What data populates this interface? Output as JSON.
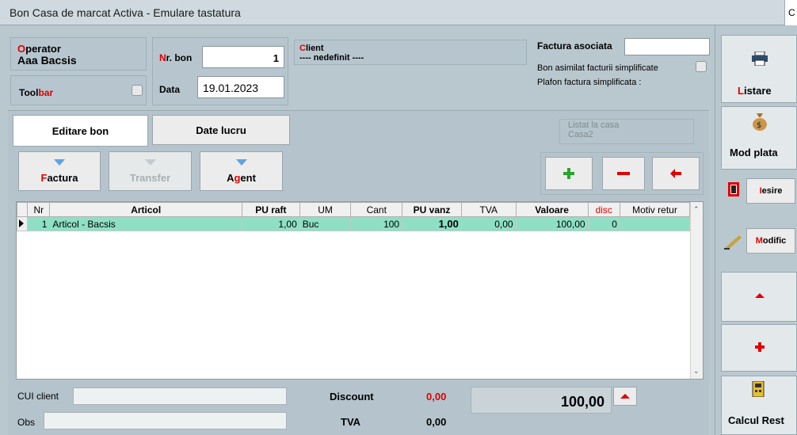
{
  "window": {
    "title": "Bon Casa de marcat Activa - Emulare tastatura",
    "corner": "C"
  },
  "operator": {
    "label_hot": "O",
    "label_rest": "perator",
    "name": "Aaa Bacsis"
  },
  "toolbar": {
    "label_hot": "Tool",
    "label_rest": "bar"
  },
  "bon": {
    "nr_label_hot": "N",
    "nr_label_rest": "r. bon",
    "nr_value": "1",
    "data_label": "Data",
    "data_value": "19.01.2023"
  },
  "client": {
    "label_hot": "C",
    "label_rest": "lient",
    "value": "---- nedefinit ----"
  },
  "factura": {
    "asociata_label": "Factura asociata",
    "asociata_value": "",
    "asimilat_label": "Bon asimilat facturii simplificate",
    "plafon_label": "Plafon factura simplificata :"
  },
  "tabs": {
    "editare": "Editare bon",
    "date": "Date lucru"
  },
  "listat": {
    "label": "Listat la casa",
    "value": "Casa2"
  },
  "actions": {
    "factura_hot": "F",
    "factura_rest": "actura",
    "transfer": "Transfer",
    "agent_a": "A",
    "agent_hot": "g",
    "agent_rest": "ent"
  },
  "grid": {
    "columns": [
      "Nr",
      "Articol",
      "PU raft",
      "UM",
      "Cant",
      "PU vanz",
      "TVA",
      "Valoare",
      "disc",
      "Motiv retur"
    ],
    "rows": [
      {
        "nr": "1",
        "articol": "Articol - Bacsis",
        "pu_raft": "1,00",
        "um": "Buc",
        "cant": "100",
        "pu_vanz": "1,00",
        "tva": "0,00",
        "valoare": "100,00",
        "disc": "0",
        "motiv": ""
      }
    ]
  },
  "footer": {
    "cui_label": "CUI client",
    "cui_value": "",
    "obs_label": "Obs",
    "obs_value": "",
    "discount_label": "Discount",
    "discount_value": "0,00",
    "tva_label": "TVA",
    "tva_value": "0,00",
    "total": "100,00"
  },
  "sidebar": {
    "listare_hot": "L",
    "listare_rest": "istare",
    "mod_plata": "Mod plata",
    "iesire_hot": "I",
    "iesire_rest": "esire",
    "modific_hot": "M",
    "modific_rest": "odific",
    "calcul_rest": "Calcul Rest"
  },
  "colors": {
    "accent_red": "#e00000",
    "row_highlight": "#8fdfc4",
    "plus_green": "#2aa52a"
  }
}
